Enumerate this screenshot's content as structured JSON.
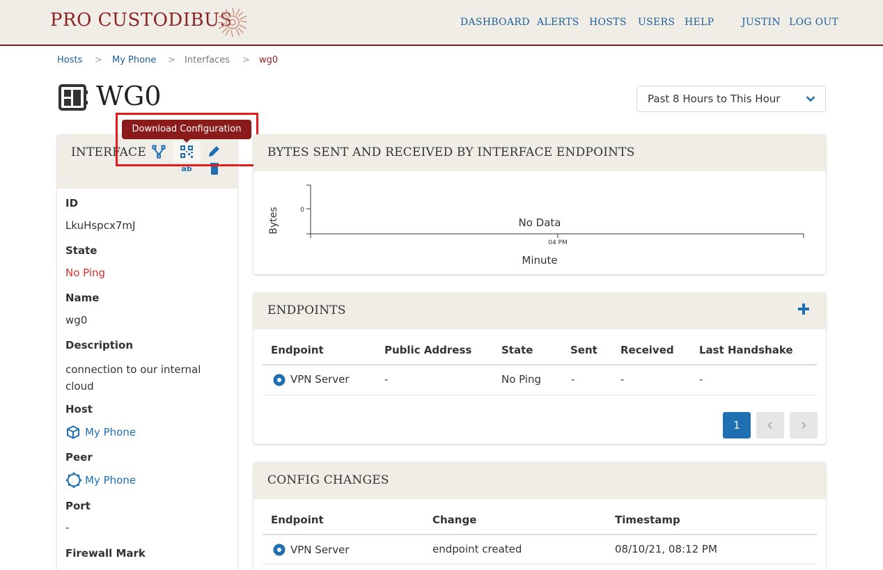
{
  "brand": {
    "name": "PRO CUSTODIBUS",
    "accent": "#8b2323"
  },
  "nav": {
    "dashboard": "DASHBOARD",
    "alerts": "ALERTS",
    "hosts": "HOSTS",
    "users": "USERS",
    "help": "HELP",
    "user": "JUSTIN",
    "logout": "LOG OUT"
  },
  "breadcrumb": {
    "hosts": "Hosts",
    "sep": ">",
    "host": "My Phone",
    "interfaces": "Interfaces",
    "current": "wg0"
  },
  "page": {
    "title": "WG0",
    "icon": "interface-card-icon"
  },
  "time_range": {
    "selected": "Past 8 Hours to This Hour"
  },
  "interface_panel": {
    "title": "INTERFACE",
    "tooltip": "Download Configuration",
    "fields": {
      "id_label": "ID",
      "id_value": "LkuHspcx7mJ",
      "state_label": "State",
      "state_value": "No Ping",
      "name_label": "Name",
      "name_value": "wg0",
      "description_label": "Description",
      "description_value": "connection to our internal cloud",
      "host_label": "Host",
      "host_value": "My Phone",
      "peer_label": "Peer",
      "peer_value": "My Phone",
      "port_label": "Port",
      "port_value": "-",
      "fwmark_label": "Firewall Mark"
    }
  },
  "bytes_chart": {
    "title": "BYTES SENT AND RECEIVED BY INTERFACE ENDPOINTS",
    "ylabel": "Bytes",
    "xlabel": "Minute",
    "ytick": "0",
    "xtick": "04 PM",
    "empty": "No Data"
  },
  "endpoints": {
    "title": "ENDPOINTS",
    "headers": {
      "endpoint": "Endpoint",
      "public_address": "Public Address",
      "state": "State",
      "sent": "Sent",
      "received": "Received",
      "last_handshake": "Last Handshake"
    },
    "rows": [
      {
        "endpoint": "VPN Server",
        "public_address": "-",
        "state": "No Ping",
        "sent": "-",
        "received": "-",
        "last_handshake": "-"
      }
    ],
    "pagination": {
      "page": "1"
    }
  },
  "config_changes": {
    "title": "CONFIG CHANGES",
    "headers": {
      "endpoint": "Endpoint",
      "change": "Change",
      "timestamp": "Timestamp"
    },
    "rows": [
      {
        "endpoint": "VPN Server",
        "change": "endpoint created",
        "timestamp": "08/10/21, 08:12 PM"
      }
    ]
  },
  "colors": {
    "link": "#1f6fb2",
    "error": "#d32f2f",
    "panel": "#efede6",
    "primary_button": "#1f6fb2"
  }
}
